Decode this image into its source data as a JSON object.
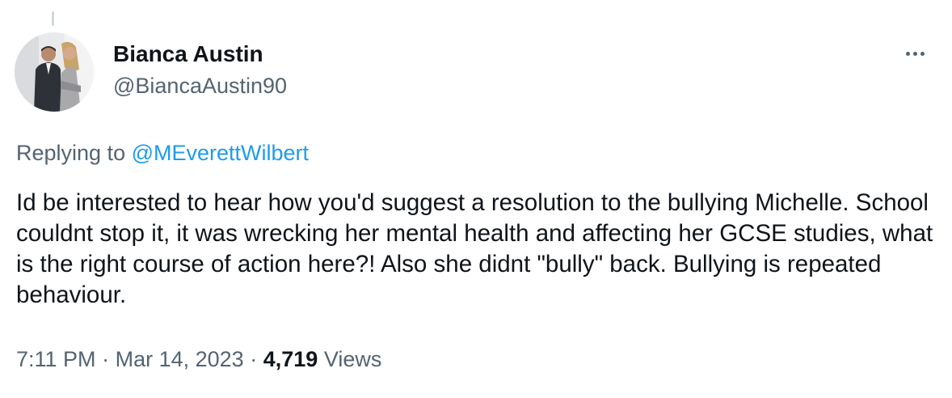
{
  "tweet": {
    "author": {
      "display_name": "Bianca Austin",
      "handle": "@BiancaAustin90"
    },
    "reply_prefix": "Replying to ",
    "reply_to": "@MEverettWilbert",
    "text": "Id be interested to hear how you'd suggest a resolution to the bullying Michelle. School couldnt stop it, it was wrecking her mental health and affecting her GCSE studies, what is the right course of action here?! Also she didnt \"bully\" back. Bullying is repeated behaviour.",
    "time": "7:11 PM",
    "separator": "·",
    "date": "Mar 14, 2023",
    "views_count": "4,719",
    "views_label": "Views"
  },
  "icons": {
    "more": "more-horizontal-icon",
    "avatar": "profile-photo"
  },
  "colors": {
    "text_primary": "#0f1419",
    "text_secondary": "#536471",
    "link": "#1d9bf0",
    "thread_line": "#cfd9de"
  }
}
